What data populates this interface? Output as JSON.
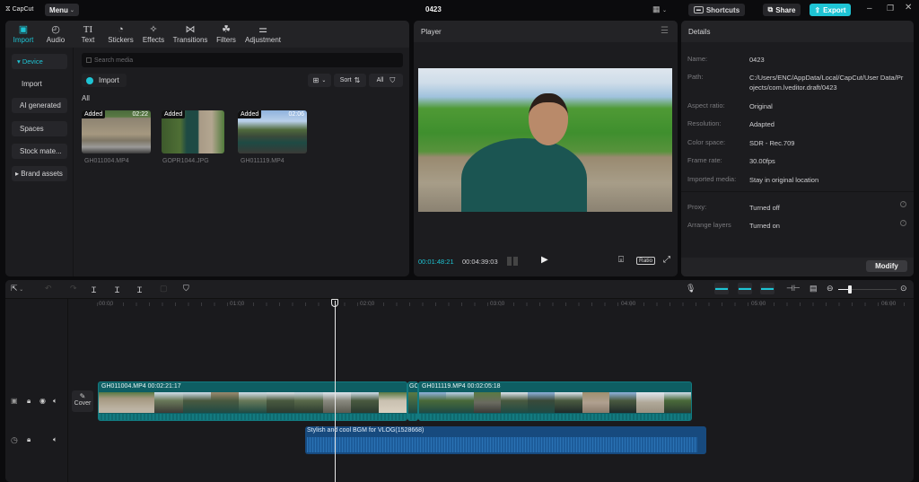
{
  "app": {
    "logo": "CapCut",
    "menu_label": "Menu",
    "project_title": "0423",
    "shortcuts_label": "Shortcuts",
    "share_label": "Share",
    "export_label": "Export",
    "accent_color": "#1ec4d4"
  },
  "media_tabs": [
    {
      "label": "Import",
      "icon": "import-icon",
      "active": true
    },
    {
      "label": "Audio",
      "icon": "audio-icon"
    },
    {
      "label": "Text",
      "icon": "text-icon"
    },
    {
      "label": "Stickers",
      "icon": "stickers-icon"
    },
    {
      "label": "Effects",
      "icon": "effects-icon"
    },
    {
      "label": "Transitions",
      "icon": "transitions-icon"
    },
    {
      "label": "Filters",
      "icon": "filters-icon"
    },
    {
      "label": "Adjustment",
      "icon": "adjustment-icon"
    }
  ],
  "sidebar": {
    "items": [
      {
        "label": "▾ Device",
        "active": true
      },
      {
        "label": "Import"
      },
      {
        "label": "AI generated"
      },
      {
        "label": "Spaces"
      },
      {
        "label": "Stock mate..."
      },
      {
        "label": "▸ Brand assets"
      }
    ]
  },
  "media": {
    "search_placeholder": "Search media",
    "import_label": "Import",
    "sort_label": "Sort",
    "filter_label": "All",
    "section_label": "All",
    "items": [
      {
        "name": "GH011004.MP4",
        "badge": "Added",
        "duration": "02:22"
      },
      {
        "name": "GOPR1044.JPG",
        "badge": "Added",
        "duration": ""
      },
      {
        "name": "GH011119.MP4",
        "badge": "Added",
        "duration": "02:06"
      }
    ]
  },
  "player": {
    "title": "Player",
    "current_time": "00:01:48:21",
    "total_time": "00:04:39:03",
    "ratio_label": "Ratio"
  },
  "details": {
    "title": "Details",
    "rows": [
      {
        "key": "Name:",
        "value": "0423"
      },
      {
        "key": "Path:",
        "value": "C:/Users/ENC/AppData/Local/CapCut/User Data/Projects/com.lveditor.draft/0423"
      },
      {
        "key": "Aspect ratio:",
        "value": "Original"
      },
      {
        "key": "Resolution:",
        "value": "Adapted"
      },
      {
        "key": "Color space:",
        "value": "SDR - Rec.709"
      },
      {
        "key": "Frame rate:",
        "value": "30.00fps"
      },
      {
        "key": "Imported media:",
        "value": "Stay in original location"
      }
    ],
    "settings": [
      {
        "key": "Proxy:",
        "value": "Turned off"
      },
      {
        "key": "Arrange layers",
        "value": "Turned on"
      }
    ],
    "modify_label": "Modify"
  },
  "timeline": {
    "ruler_labels": [
      "00:00",
      "01:00",
      "02:00",
      "03:00",
      "04:00",
      "05:00",
      "06:00"
    ],
    "cover_label": "Cover",
    "video_clips": [
      {
        "label": "GH011004.MP4   00:02:21:17"
      },
      {
        "label": "GO"
      },
      {
        "label": "GH011119.MP4   00:02:05:18"
      }
    ],
    "audio_clip": {
      "label": "Stylish and cool BGM for VLOG(1528668)"
    },
    "zoom_level": 0.1
  }
}
